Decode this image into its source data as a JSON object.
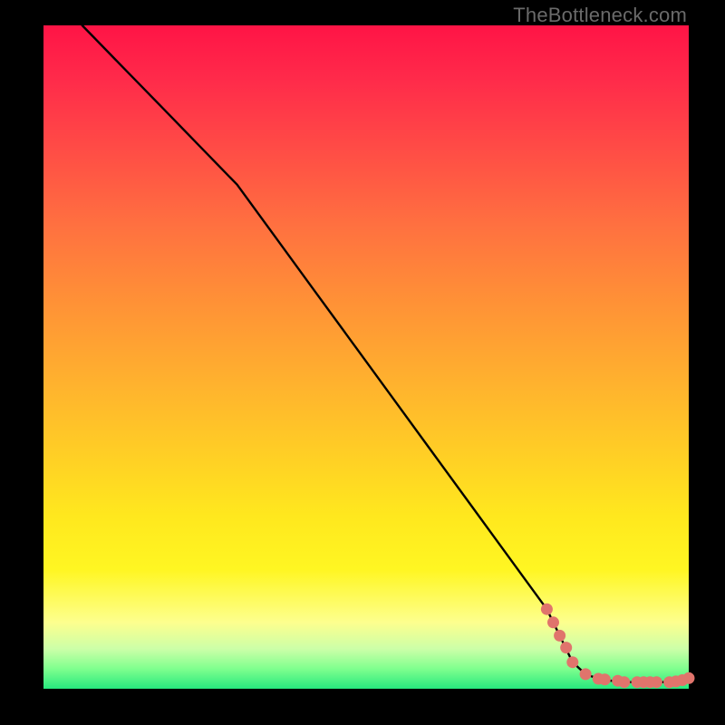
{
  "watermark": "TheBottleneck.com",
  "chart_data": {
    "type": "line",
    "title": "",
    "xlabel": "",
    "ylabel": "",
    "xlim": [
      0,
      100
    ],
    "ylim": [
      0,
      100
    ],
    "grid": false,
    "series": [
      {
        "name": "bottleneck-curve",
        "x": [
          6,
          12,
          18,
          24,
          30,
          36,
          42,
          48,
          54,
          60,
          66,
          72,
          78,
          80,
          82,
          84,
          86,
          88,
          90,
          92,
          94,
          96,
          98,
          100
        ],
        "y": [
          100,
          94,
          88,
          82,
          76,
          68,
          60,
          52,
          44,
          36,
          28,
          20,
          12,
          8,
          4.0,
          2.2,
          1.5,
          1.2,
          1.0,
          1.0,
          1.0,
          1.0,
          1.1,
          1.6
        ]
      }
    ],
    "highlight_points": {
      "name": "best-match-region",
      "color": "#e0746c",
      "x": [
        78,
        79,
        80,
        81,
        82,
        84,
        86,
        87,
        89,
        90,
        92,
        93,
        94,
        95,
        97,
        98,
        99,
        100
      ],
      "y": [
        12,
        10,
        8,
        6.2,
        4.0,
        2.2,
        1.5,
        1.4,
        1.2,
        1.0,
        1.0,
        1.0,
        1.0,
        1.0,
        1.0,
        1.1,
        1.3,
        1.6
      ]
    },
    "background_gradient": {
      "top": "#ff1446",
      "upper_mid": "#ff9236",
      "mid": "#ffe81e",
      "lower_mid": "#fdff8e",
      "bottom": "#27e97e"
    }
  }
}
